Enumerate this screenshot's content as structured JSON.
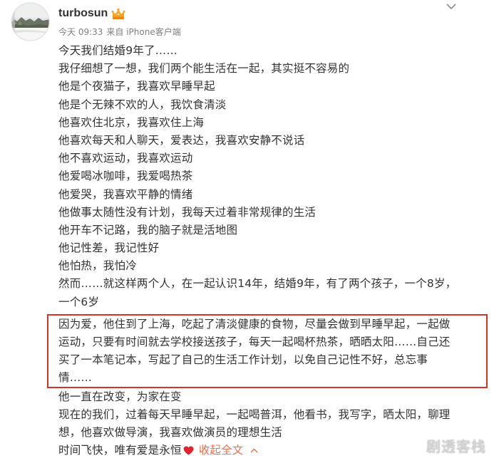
{
  "post": {
    "author": {
      "name": "turbosun",
      "avatar_icon": "avatar-image",
      "badge_icon": "vip-badge-icon"
    },
    "meta": {
      "time": "今天 09:33",
      "source": "来自 iPhone客户端"
    },
    "menu_icon": "chevron-down-icon",
    "intro_lines": [
      "今天我们结婚9年了……",
      "我仔细想了一想，我们两个能生活在一起，其实挺不容易的",
      "他是个夜猫子，我喜欢早睡早起",
      "他是个无辣不欢的人，我饮食清淡",
      "他喜欢住北京，我喜欢住上海",
      "他喜欢每天和人聊天，爱表达，我喜欢安静不说话",
      "他不喜欢运动，我喜欢运动",
      "他爱喝冰咖啡，我爱喝热茶",
      "他爱哭，我喜欢平静的情绪",
      "他做事太随性没有计划，我每天过着非常规律的生活",
      "他开车不记路，我的脑子就是活地图",
      "他记性差，我记性好",
      "他怕热，我怕冷",
      "然而……就这样两个人，在一起认识14年，结婚9年，有了两个孩子，一个8岁，",
      "一个6岁"
    ],
    "highlight_lines": [
      "因为爱，他住到了上海，吃起了清淡健康的食物，尽量会做到早睡早起，一起做",
      "运动，只要有时间就去学校接送孩子，每天一起喝杯热茶，晒晒太阳……自己还",
      "买了一本笔记本，写起了自己的生活工作计划，以免自己记性不好，总忘事",
      "情……"
    ],
    "outro_lines": [
      "他一直在改变，为家在变",
      "现在的我们，过着每天早睡早起，一起喝普洱，他看书，我写字，晒太阳，聊理",
      "想，他喜欢做导演，我喜欢做演员的理想生活"
    ],
    "last_line": {
      "text": "时间飞快，唯有爱是永恒",
      "heart_icon": "heart-icon",
      "collapse_label": "收起全文",
      "collapse_icon": "chevron-up-icon"
    }
  },
  "watermark": "剧透客栈",
  "colors": {
    "text": "#333333",
    "meta": "#808080",
    "link": "#eb7350",
    "highlight_border": "#d7312b",
    "heart": "#e0242f",
    "watermark": "#d9d9d9"
  }
}
